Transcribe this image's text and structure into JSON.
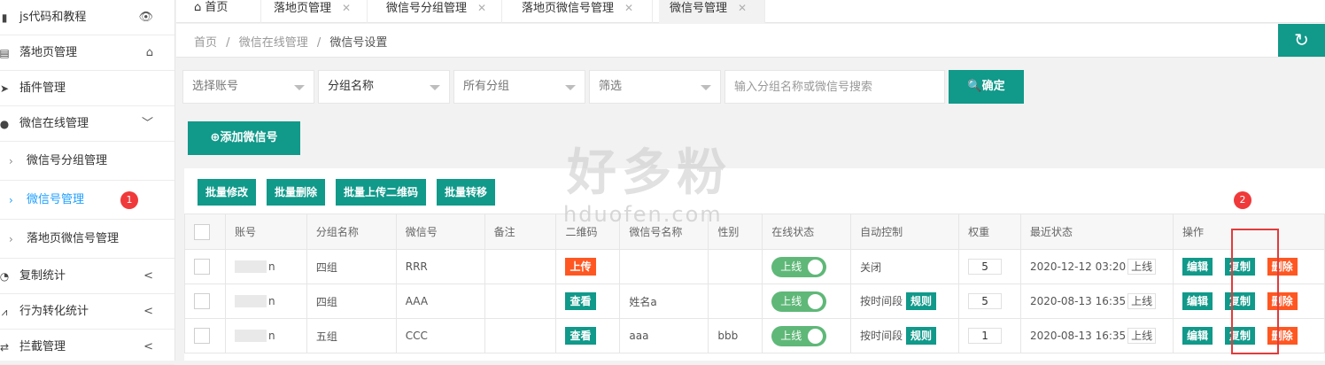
{
  "sidebar": {
    "items": [
      {
        "label": "js代码和教程",
        "icon": "bookmark-icon",
        "right": "👁"
      },
      {
        "label": "落地页管理",
        "icon": "page-icon",
        "right": "⌂"
      },
      {
        "label": "插件管理",
        "icon": "send-icon"
      },
      {
        "label": "微信在线管理",
        "icon": "wechat-icon",
        "right": "﹀"
      }
    ],
    "sub_items": [
      {
        "label": "微信号分组管理"
      },
      {
        "label": "微信号管理",
        "badge": "1"
      },
      {
        "label": "落地页微信号管理"
      }
    ],
    "bottom_items": [
      {
        "label": "复制统计",
        "icon": "pie-chart-icon",
        "right": "<"
      },
      {
        "label": "行为转化统计",
        "icon": "line-chart-icon",
        "right": "<"
      },
      {
        "label": "拦截管理",
        "icon": "swap-icon",
        "right": "<"
      }
    ]
  },
  "tabs": [
    {
      "label": "首页",
      "icon": "home-icon"
    },
    {
      "label": "落地页管理"
    },
    {
      "label": "微信号分组管理"
    },
    {
      "label": "落地页微信号管理"
    },
    {
      "label": "微信号管理"
    }
  ],
  "breadcrumb": [
    "首页",
    "/",
    "微信在线管理",
    "/",
    "微信号设置"
  ],
  "filters": {
    "account": "选择账号",
    "group_name": "分组名称",
    "all_groups": "所有分组",
    "filter": "筛选",
    "search_placeholder": "输入分组名称或微信号搜索",
    "confirm": "确定"
  },
  "add_button": "添加微信号",
  "batch": [
    "批量修改",
    "批量删除",
    "批量上传二维码",
    "批量转移"
  ],
  "table": {
    "headers": [
      "账号",
      "分组名称",
      "微信号",
      "备注",
      "二维码",
      "微信号名称",
      "性别",
      "在线状态",
      "自动控制",
      "权重",
      "最近状态",
      "操作"
    ],
    "rows": [
      {
        "account": "n",
        "group": "四组",
        "wechat": "RRR",
        "note": "",
        "qr": "上传",
        "name": "",
        "gender": "",
        "status": "上线",
        "auto": "关闭",
        "auto_rule": "",
        "weight": "5",
        "recent": "2020-12-12 03:20",
        "recent_btn": "上线"
      },
      {
        "account": "n",
        "group": "四组",
        "wechat": "AAA",
        "note": "",
        "qr": "查看",
        "name": "姓名a",
        "gender": "",
        "status": "上线",
        "auto": "按时间段",
        "auto_rule": "规则",
        "weight": "5",
        "recent": "2020-08-13 16:35",
        "recent_btn": "上线"
      },
      {
        "account": "n",
        "group": "五组",
        "wechat": "CCC",
        "note": "",
        "qr": "查看",
        "name": "aaa",
        "gender": "bbb",
        "status": "上线",
        "auto": "按时间段",
        "auto_rule": "规则",
        "weight": "1",
        "recent": "2020-08-13 16:35",
        "recent_btn": "上线"
      }
    ],
    "actions": {
      "edit": "编辑",
      "copy": "复制",
      "delete": "删除"
    }
  },
  "annotation_badge_2": "2",
  "watermark": {
    "text": "好多粉",
    "url": "hduofen.com"
  }
}
